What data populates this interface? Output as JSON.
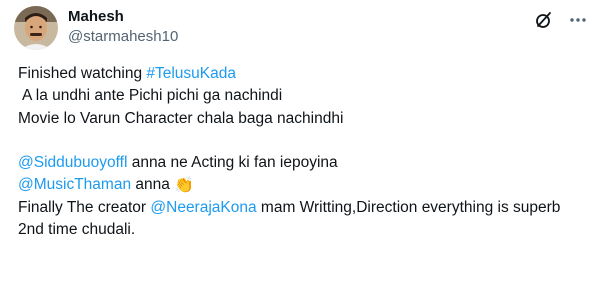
{
  "author": {
    "name": "Mahesh",
    "handle": "@starmahesh10"
  },
  "icons": {
    "grok": "grok-icon",
    "more": "more-icon",
    "clap": "👏"
  },
  "tweet": {
    "line1_text": "Finished watching ",
    "line1_hashtag": "#TelusuKada",
    "line2": "A la undhi ante Pichi pichi ga nachindi",
    "line3": "Movie lo Varun Character chala baga nachindhi",
    "line5_mention": "@Siddubuoyoffl",
    "line5_text": " anna ne Acting ki fan iepoyina",
    "line6_mention": "@MusicThaman",
    "line6_text": " anna ",
    "line7_text": "Finally The creator ",
    "line7_mention": "@NeerajaKona",
    "line7_rest": " mam Writting,Direction everything is superb",
    "line8": "2nd time chudali."
  },
  "colors": {
    "link": "#1d9bf0",
    "text": "#0f1419",
    "muted": "#536471"
  }
}
